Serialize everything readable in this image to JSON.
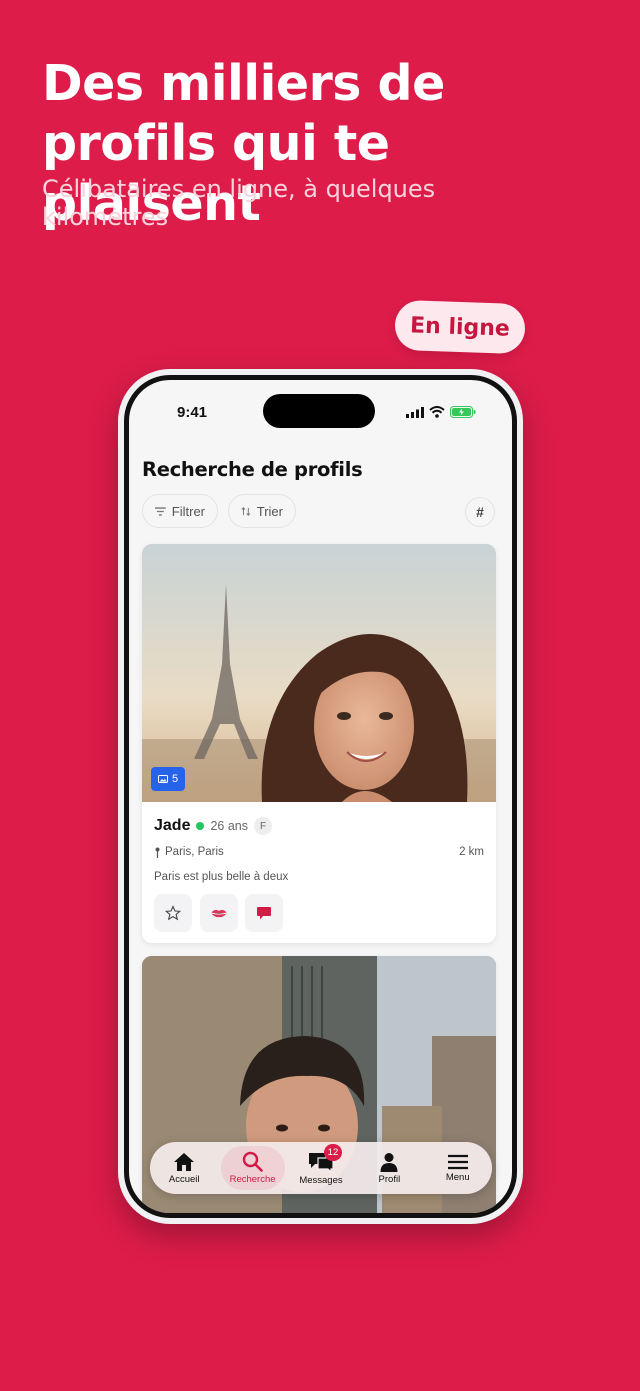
{
  "hero": {
    "headline": "Des milliers de profils qui te plaisent",
    "subline": "Célibataires en ligne, à quelques kilomètres",
    "online_badge": "En ligne"
  },
  "status_bar": {
    "time": "9:41"
  },
  "screen": {
    "title": "Recherche de profils",
    "filter_label": "Filtrer",
    "sort_label": "Trier",
    "hash_label": "#"
  },
  "profiles": [
    {
      "photo_count": "5",
      "name": "Jade",
      "age": "26 ans",
      "gender": "F",
      "location": "Paris, Paris",
      "distance": "2 km",
      "bio": "Paris est plus belle à deux"
    },
    {}
  ],
  "nav": {
    "items": [
      {
        "label": "Accueil",
        "icon": "home-icon"
      },
      {
        "label": "Recherche",
        "icon": "search-icon"
      },
      {
        "label": "Messages",
        "icon": "chat-icon",
        "badge": "12"
      },
      {
        "label": "Profil",
        "icon": "user-icon"
      },
      {
        "label": "Menu",
        "icon": "menu-icon"
      }
    ]
  },
  "colors": {
    "brand": "#dd1c4a",
    "online": "#22c55e",
    "photo_badge": "#2563eb"
  }
}
